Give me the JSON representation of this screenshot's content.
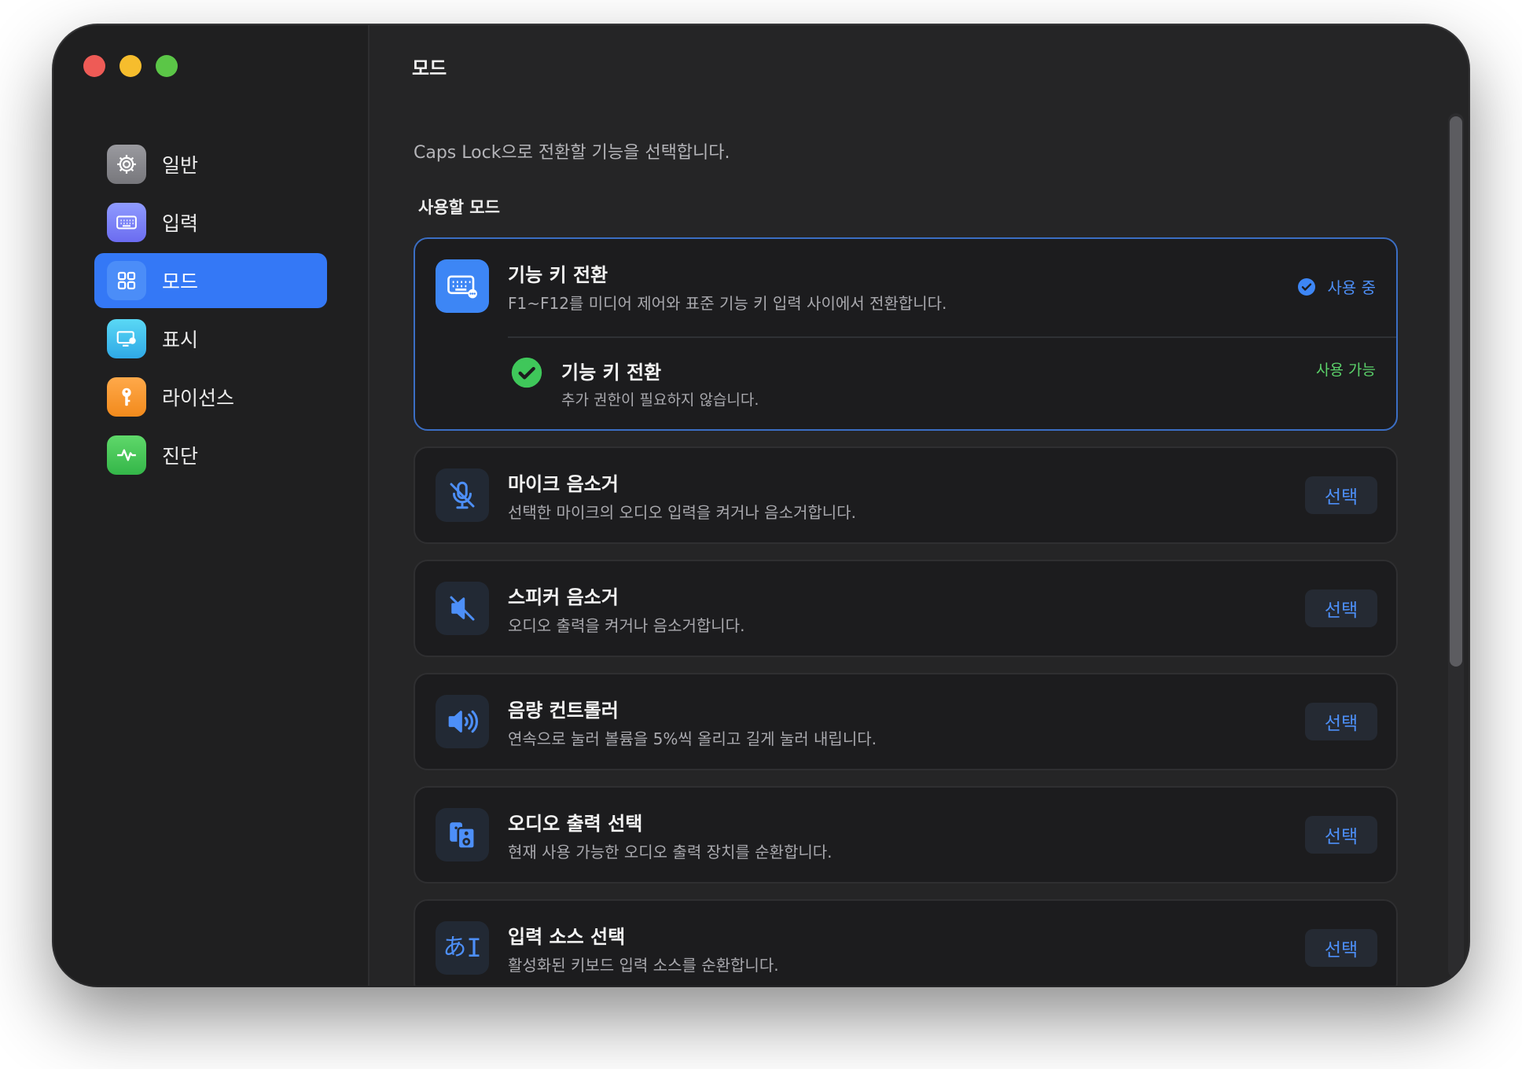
{
  "window": {
    "title": "모드"
  },
  "sidebar": {
    "items": [
      {
        "label": "일반",
        "icon": "gear-icon",
        "color": "#8e8e93",
        "active": false
      },
      {
        "label": "입력",
        "icon": "keyboard-icon",
        "color": "#7b7ef5",
        "active": false
      },
      {
        "label": "모드",
        "icon": "grid-icon",
        "color": "#3478f6",
        "active": true
      },
      {
        "label": "표시",
        "icon": "display-icon",
        "color": "#38bdf0",
        "active": false
      },
      {
        "label": "라이선스",
        "icon": "key-icon",
        "color": "#f59a2c",
        "active": false
      },
      {
        "label": "진단",
        "icon": "pulse-icon",
        "color": "#45c556",
        "active": false
      }
    ]
  },
  "main": {
    "description": "Caps Lock으로 전환할 기능을 선택합니다.",
    "section_title": "사용할 모드",
    "selected_mode": {
      "title": "기능 키 전환",
      "subtitle": "F1~F12를 미디어 제어와 표준 기능 키 입력 사이에서 전환합니다.",
      "status": "사용 중",
      "requirement": {
        "title": "기능 키 전환",
        "subtitle": "추가 권한이 필요하지 않습니다.",
        "status": "사용 가능"
      }
    },
    "modes": [
      {
        "title": "마이크 음소거",
        "subtitle": "선택한 마이크의 오디오 입력을 켜거나 음소거합니다.",
        "button": "선택",
        "icon": "mic-mute-icon"
      },
      {
        "title": "스피커 음소거",
        "subtitle": "오디오 출력을 켜거나 음소거합니다.",
        "button": "선택",
        "icon": "speaker-mute-icon"
      },
      {
        "title": "음량 컨트롤러",
        "subtitle": "연속으로 눌러 볼륨을 5%씩 올리고 길게 눌러 내립니다.",
        "button": "선택",
        "icon": "volume-icon"
      },
      {
        "title": "오디오 출력 선택",
        "subtitle": "현재 사용 가능한 오디오 출력 장치를 순환합니다.",
        "button": "선택",
        "icon": "speakers-icon"
      },
      {
        "title": "입력 소스 선택",
        "subtitle": "활성화된 키보드 입력 소스를 순환합니다.",
        "button": "선택",
        "icon": "input-source-icon",
        "glyph": "あ"
      }
    ]
  },
  "colors": {
    "accent": "#3478f6",
    "success": "#5bd16a",
    "card": "#1c1c1e"
  }
}
